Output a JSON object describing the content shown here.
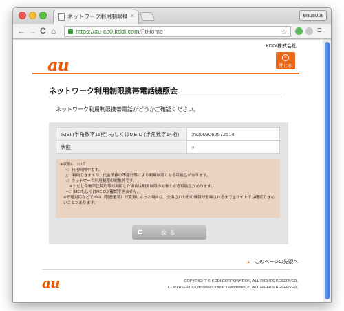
{
  "browser": {
    "tab_title": "ネットワーク利用制限携帯電",
    "tab_close": "×",
    "user": "enusuta",
    "url_host": "https://au-cs0.kddi.com",
    "url_path": "/FtHome",
    "nav": {
      "back": "←",
      "forward": "→",
      "reload": "C",
      "home": "⌂",
      "star": "☆",
      "menu": "≡"
    }
  },
  "header": {
    "company": "KDDI株式会社",
    "logo": "au",
    "close_icon": "×",
    "close_label": "閉じる",
    "accent_color": "#e8691b"
  },
  "main": {
    "title": "ネットワーク利用制限携帯電話機照会",
    "intro": "ネットワーク利用制限携帯電話かどうかご確認ください。",
    "table": [
      {
        "label": "IMEI (半角数字15桁) もしくはMEID (半角数字14桁)",
        "value": "352003062572514"
      },
      {
        "label": "状態",
        "value": "○"
      }
    ],
    "notes": {
      "heading": "※状態について",
      "items": [
        "×：利用制限中です。",
        "△：利用できますが、代金債務の不履行等により利用制限となる可能性があります。",
        "○：ネットワーク利用制限の対象外です。",
        "※ただし今後不正契約等が判明した場合は利用制限の対象となる可能性があります。",
        "－：IMEIもしくはMEIDが確認できません。"
      ],
      "footnote": "※修理対応などでIMEI（製造番号）が変更になった場合は、交換された旧の情報が反映されるまで当サイトでは確認できないことがあります。"
    },
    "back_label": "戻る"
  },
  "footer": {
    "top_link": "このページの先頭へ",
    "top_arrow": "▲",
    "logo": "au",
    "copyright1": "COPYRIGHT © KDDI CORPORATION, ALL RIGHTS RESERVED.",
    "copyright2": "COPYRIGHT © Okinawa Cellular Telephone Co., ALL RIGHTS RESERVED."
  }
}
